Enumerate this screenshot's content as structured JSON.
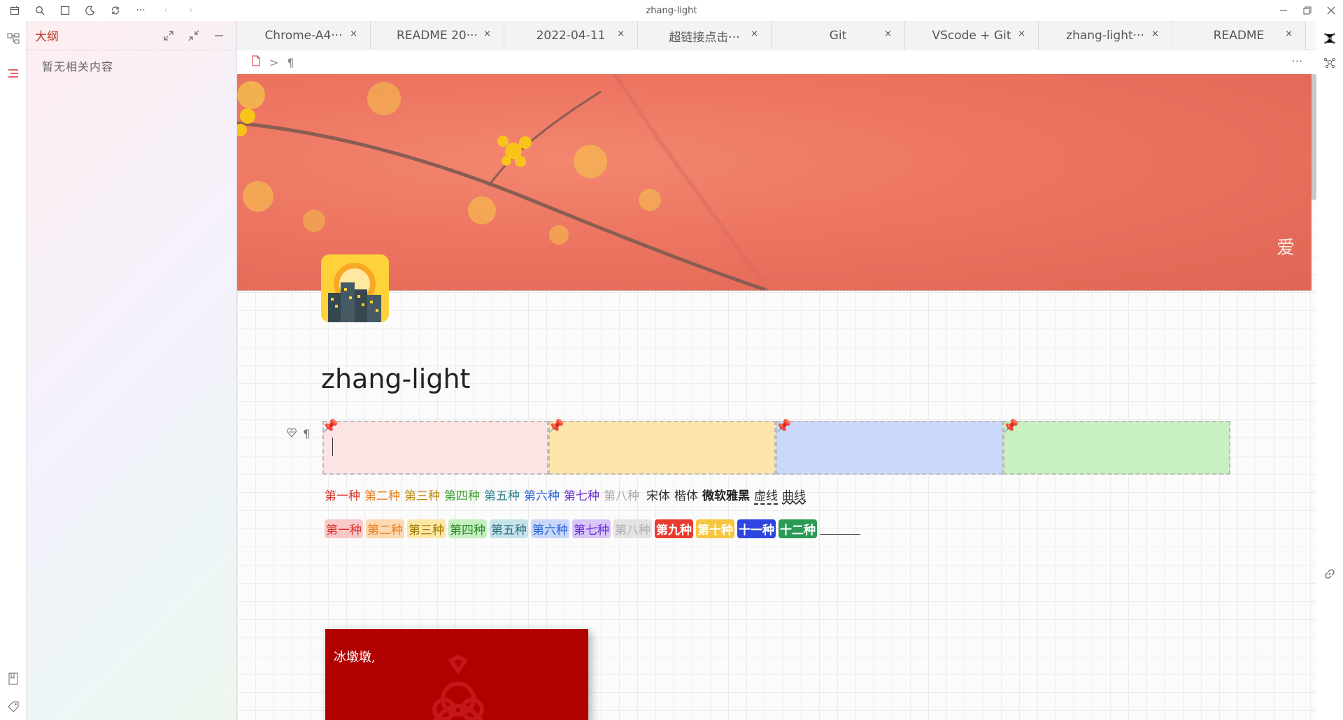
{
  "window": {
    "title": "zhang-light"
  },
  "outline": {
    "title": "大纲",
    "empty_text": "暂无相关内容"
  },
  "tabs": [
    {
      "label": "Chrome-A4···"
    },
    {
      "label": "README 20···"
    },
    {
      "label": "2022-04-11"
    },
    {
      "label": "超链接点击···"
    },
    {
      "label": "Git"
    },
    {
      "label": "VScode + Git"
    },
    {
      "label": "zhang-light···"
    },
    {
      "label": "README"
    }
  ],
  "tab_close": "×",
  "breadcrumb": {
    "separator": ">",
    "block_symbol": "¶",
    "more": "···"
  },
  "document": {
    "title": "zhang-light",
    "banner_char": "爱",
    "sticky_colors": [
      "#fce4e4",
      "#fde5ab",
      "#cad9fb",
      "#c8f0c0"
    ],
    "font_samples": [
      {
        "text": "第一种",
        "color": "#d9342b"
      },
      {
        "text": "第二种",
        "color": "#e97b1c"
      },
      {
        "text": "第三种",
        "color": "#b98a0a"
      },
      {
        "text": "第四种",
        "color": "#3a9d2f"
      },
      {
        "text": "第五种",
        "color": "#2f7f8f"
      },
      {
        "text": "第六种",
        "color": "#2a62d6"
      },
      {
        "text": "第七种",
        "color": "#6a2fd0"
      },
      {
        "text": "第八种",
        "color": "#aaaaaa"
      },
      {
        "text": "宋体",
        "color": "#333333"
      },
      {
        "text": "楷体",
        "color": "#333333"
      },
      {
        "text": "微软雅黑",
        "color": "#222222"
      },
      {
        "text": "虚线",
        "color": "#333333"
      },
      {
        "text": "曲线",
        "color": "#333333"
      }
    ],
    "highlight_samples": [
      {
        "text": "第一种",
        "bg": "#f9c9c9",
        "fg": "#d9342b"
      },
      {
        "text": "第二种",
        "bg": "#fcd9b0",
        "fg": "#e97b1c"
      },
      {
        "text": "第三种",
        "bg": "#fbe7a6",
        "fg": "#a57800"
      },
      {
        "text": "第四种",
        "bg": "#c6efc0",
        "fg": "#2f8a2a"
      },
      {
        "text": "第五种",
        "bg": "#c6e2ea",
        "fg": "#2f7080"
      },
      {
        "text": "第六种",
        "bg": "#c8d7fa",
        "fg": "#2a62d6"
      },
      {
        "text": "第七种",
        "bg": "#d8c6f7",
        "fg": "#6a2fd0"
      },
      {
        "text": "第八种",
        "bg": "#e4e4e4",
        "fg": "#b0b0b0"
      },
      {
        "text": "第九种",
        "bg": "#e83a2f",
        "fg": "#ffffff"
      },
      {
        "text": "第十种",
        "bg": "#f7c640",
        "fg": "#ffffff"
      },
      {
        "text": "十一种",
        "bg": "#2e45e0",
        "fg": "#ffffff"
      },
      {
        "text": "十二种",
        "bg": "#2a9a55",
        "fg": "#ffffff"
      }
    ],
    "card_text": "冰墩墩,"
  },
  "icons": {
    "calendar": "calendar-icon",
    "search": "search-icon",
    "square": "square-icon",
    "moon": "moon-icon",
    "sync": "sync-icon",
    "more": "more-icon",
    "back": "back-icon",
    "forward": "forward-icon",
    "minimize": "minimize-icon",
    "restore": "restore-icon",
    "close": "close-icon"
  }
}
